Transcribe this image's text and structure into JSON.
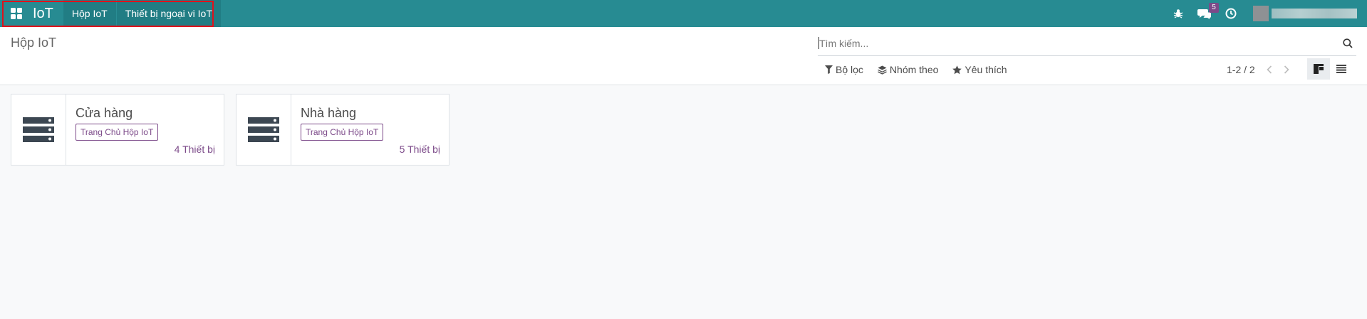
{
  "navbar": {
    "app_name": "IoT",
    "menu": [
      "Hộp IoT",
      "Thiết bị ngoại vi IoT"
    ],
    "message_count": "5",
    "icons": [
      "apps-grid-icon",
      "bug-icon",
      "comments-icon",
      "clock-icon"
    ],
    "colors": {
      "navbar": "#278b92",
      "highlight": "#e0121b",
      "accent": "#7c4a89"
    }
  },
  "control_panel": {
    "title": "Hộp IoT",
    "search_placeholder": "Tìm kiếm...",
    "filters": {
      "filter_label": "Bộ lọc",
      "group_label": "Nhóm theo",
      "favorite_label": "Yêu thích"
    },
    "pager": "1-2 / 2"
  },
  "cards": [
    {
      "title": "Cửa hàng",
      "tag": "Trang Chủ Hộp IoT",
      "count": "4 Thiết bị"
    },
    {
      "title": "Nhà hàng",
      "tag": "Trang Chủ Hộp IoT",
      "count": "5 Thiết bị"
    }
  ]
}
